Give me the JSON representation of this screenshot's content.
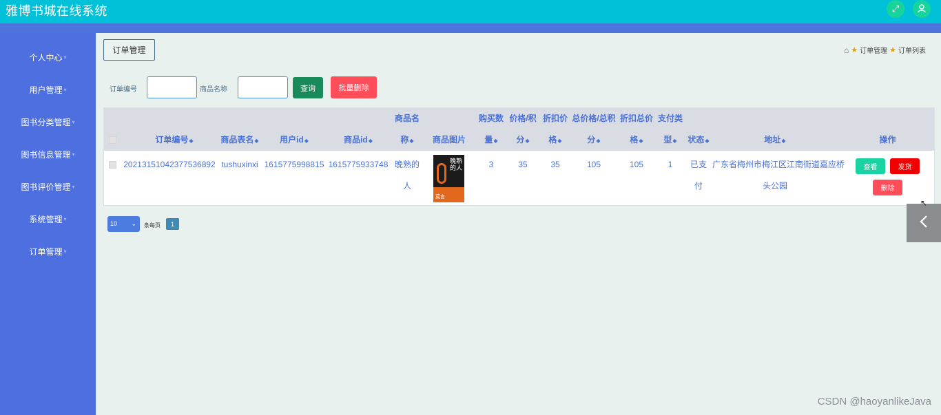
{
  "app": {
    "title": "雅博书城在线系统"
  },
  "header": {
    "fullscreen_icon": "expand-icon",
    "user_icon": "user-icon"
  },
  "sidebar": {
    "items": [
      {
        "label": "个人中心"
      },
      {
        "label": "用户管理"
      },
      {
        "label": "图书分类管理"
      },
      {
        "label": "图书信息管理"
      },
      {
        "label": "图书评价管理"
      },
      {
        "label": "系统管理"
      },
      {
        "label": "订单管理"
      }
    ]
  },
  "page": {
    "tag": "订单管理",
    "breadcrumb": [
      "订单管理",
      "订单列表"
    ]
  },
  "search": {
    "order_no_label": "订单编号",
    "order_no_value": "",
    "goods_name_label": "商品名称",
    "goods_name_value": "",
    "query_button": "查询",
    "batch_delete_button": "批量删除"
  },
  "table": {
    "columns": [
      {
        "line1": "",
        "line2": "订单编号"
      },
      {
        "line1": "",
        "line2": "商品表名"
      },
      {
        "line1": "",
        "line2": "用户id"
      },
      {
        "line1": "",
        "line2": "商品id"
      },
      {
        "line1": "商品名",
        "line2": "称"
      },
      {
        "line1": "",
        "line2": "商品图片"
      },
      {
        "line1": "购买数",
        "line2": "量"
      },
      {
        "line1": "价格/积",
        "line2": "分"
      },
      {
        "line1": "折扣价",
        "line2": "格"
      },
      {
        "line1": "总价格/总积",
        "line2": "分"
      },
      {
        "line1": "折扣总价",
        "line2": "格"
      },
      {
        "line1": "支付类",
        "line2": "型"
      },
      {
        "line1": "",
        "line2": "状态"
      },
      {
        "line1": "",
        "line2": "地址"
      },
      {
        "line1": "",
        "line2": "操作"
      }
    ],
    "rows": [
      {
        "order_no": "20213151042377536892",
        "table_name": "tushuxinxi",
        "user_id": "1615775998815",
        "goods_id": "1615775933748",
        "goods_name_1": "晚熟的",
        "goods_name_2": "人",
        "image_title": "晚熟的人",
        "image_author": "莫言",
        "quantity": "3",
        "price": "35",
        "discount_price": "35",
        "total_price": "105",
        "discount_total": "105",
        "pay_type": "1",
        "status_1": "已支",
        "status_2": "付",
        "address_1": "广东省梅州市梅江区江南街道嘉应桥",
        "address_2": "头公园",
        "view_button": "查看",
        "ship_button": "发货",
        "delete_button": "删除"
      }
    ]
  },
  "pager": {
    "page_size": "10",
    "per_page_text": "条每页",
    "current_page": "1"
  },
  "watermark": "CSDN @haoyanlikeJava",
  "colors": {
    "topbar": "#00c1d8",
    "sidebar": "#4d6fe0",
    "accent_text": "#4a72d6",
    "query_button": "#198a5a",
    "danger": "#ff4d5a",
    "ship": "#f00000",
    "view": "#19d3a2"
  }
}
